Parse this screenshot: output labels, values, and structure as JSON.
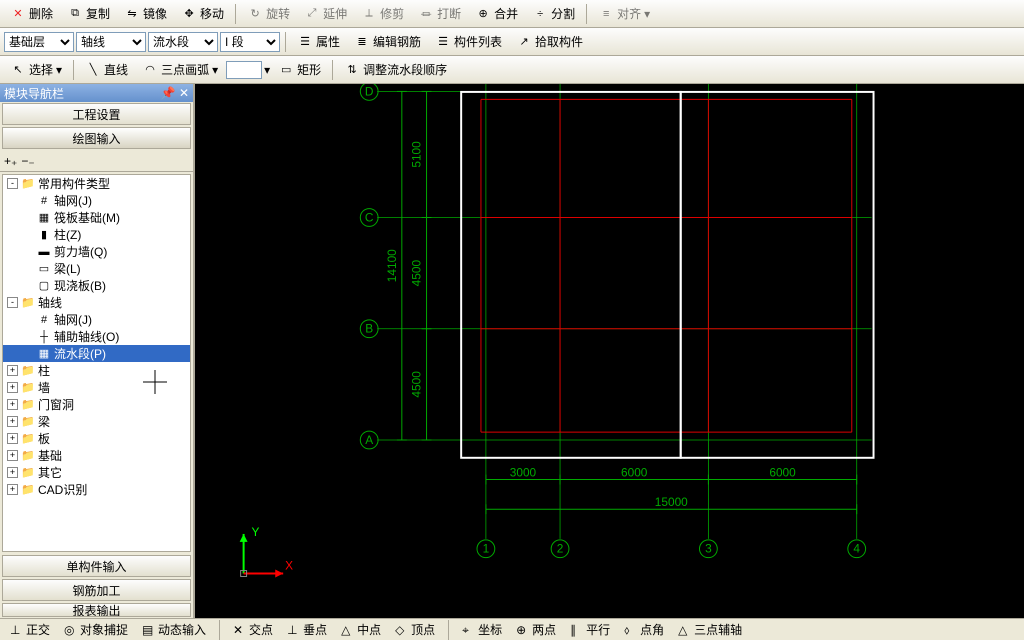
{
  "toolbar1": {
    "delete": "删除",
    "copy": "复制",
    "mirror": "镜像",
    "move": "移动",
    "rotate": "旋转",
    "extend": "延伸",
    "trim": "修剪",
    "break": "打断",
    "merge": "合并",
    "split": "分割",
    "align": "对齐"
  },
  "toolbar2": {
    "layer": "基础层",
    "axis": "轴线",
    "segment": "流水段",
    "span": "I 段",
    "properties": "属性",
    "edit_rebar": "编辑钢筋",
    "member_list": "构件列表",
    "pick_member": "拾取构件"
  },
  "toolbar3": {
    "select": "选择",
    "line": "直线",
    "arc3pt": "三点画弧",
    "rect": "矩形",
    "adjust_seq": "调整流水段顺序"
  },
  "left": {
    "title": "模块导航栏",
    "btn1": "工程设置",
    "btn2": "绘图输入",
    "btn_bottom1": "单构件输入",
    "btn_bottom2": "钢筋加工",
    "btn_bottom3": "报表输出"
  },
  "tree": {
    "root": "常用构件类型",
    "items1": [
      {
        "label": "轴网(J)",
        "icon": "#"
      },
      {
        "label": "筏板基础(M)",
        "icon": "▦"
      },
      {
        "label": "柱(Z)",
        "icon": "▮"
      },
      {
        "label": "剪力墙(Q)",
        "icon": "▬"
      },
      {
        "label": "梁(L)",
        "icon": "▭"
      },
      {
        "label": "现浇板(B)",
        "icon": "▢"
      }
    ],
    "axis_group": "轴线",
    "items2": [
      {
        "label": "轴网(J)",
        "icon": "#"
      },
      {
        "label": "辅助轴线(O)",
        "icon": "┼"
      },
      {
        "label": "流水段(P)",
        "icon": "▦",
        "sel": true
      }
    ],
    "groups": [
      "柱",
      "墙",
      "门窗洞",
      "梁",
      "板",
      "基础",
      "其它",
      "CAD识别"
    ]
  },
  "canvas": {
    "rows": [
      "D",
      "C",
      "B",
      "A"
    ],
    "cols": [
      "1",
      "2",
      "3",
      "4"
    ],
    "h_dims": [
      "3000",
      "6000",
      "6000"
    ],
    "h_total": "15000",
    "v_dims": [
      "5100",
      "4500",
      "4500"
    ],
    "v_total": "14100",
    "axis_y": "Y",
    "axis_x": "X"
  },
  "status": {
    "ortho": "正交",
    "osnap": "对象捕捉",
    "dyninput": "动态输入",
    "intersect": "交点",
    "perp": "垂点",
    "mid": "中点",
    "vertex": "顶点",
    "coord": "坐标",
    "twopoint": "两点",
    "parallel": "平行",
    "endpoint": "点角",
    "tripoint": "三点辅轴"
  }
}
